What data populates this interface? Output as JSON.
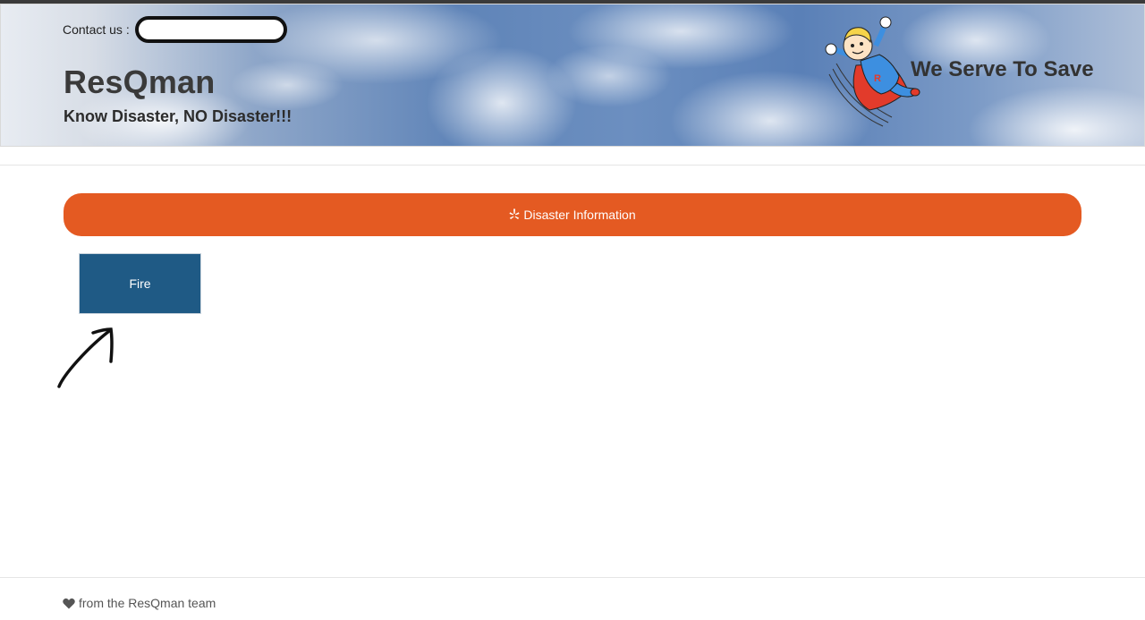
{
  "header": {
    "contact_label": "Contact us :",
    "contact_input_value": "",
    "brand_title": "ResQman",
    "tagline": "Know Disaster, NO Disaster!!!",
    "motto": "We Serve To Save",
    "mascot_icon": "superhero-mascot-icon"
  },
  "main": {
    "disaster_button_label": "Disaster Information",
    "disaster_button_icon": "yelp-icon",
    "disaster_button_color": "#e45a22",
    "tiles": [
      {
        "label": "Fire",
        "color": "#1f5a85"
      }
    ],
    "annotation_icon": "arrow-up-right-icon"
  },
  "footer": {
    "text": "from the ResQman team",
    "icon": "heart-icon"
  }
}
